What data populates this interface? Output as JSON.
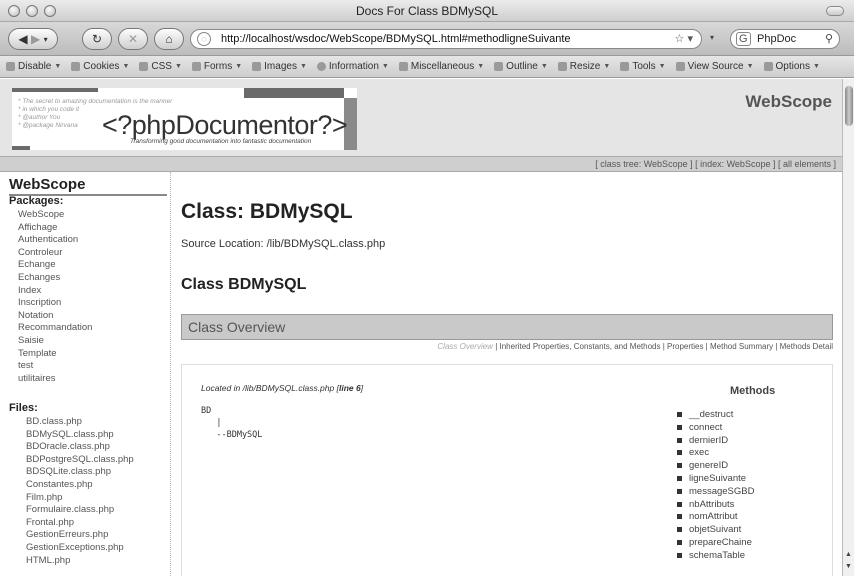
{
  "window": {
    "title": "Docs For Class BDMySQL"
  },
  "nav": {
    "url": "http://localhost/wsdoc/WebScope/BDMySQL.html#methodligneSuivante",
    "search_value": "PhpDoc"
  },
  "devtoolbar": {
    "items": [
      "Disable",
      "Cookies",
      "CSS",
      "Forms",
      "Images",
      "Information",
      "Miscellaneous",
      "Outline",
      "Resize",
      "Tools",
      "View Source",
      "Options"
    ]
  },
  "header": {
    "logo_comment": [
      "* The secret to amazing documentation is the manner",
      "* in which you code it",
      "* @author You",
      "* @package Nirvana"
    ],
    "logo_title": "<?phpDocumentor?>",
    "logo_tagline": "Transforming good documentation into fantastic documentation",
    "brand": "WebScope",
    "links": "[ class tree: WebScope ] [ index: WebScope ] [ all elements ]"
  },
  "sidebar": {
    "title": "WebScope",
    "packages_label": "Packages:",
    "packages": [
      "WebScope",
      "Affichage",
      "Authentication",
      "Controleur",
      "Echange",
      "Echanges",
      "Index",
      "Inscription",
      "Notation",
      "Recommandation",
      "Saisie",
      "Template",
      "test",
      "utilitaires"
    ],
    "files_label": "Files:",
    "files": [
      "BD.class.php",
      "BDMySQL.class.php",
      "BDOracle.class.php",
      "BDPostgreSQL.class.php",
      "BDSQLite.class.php",
      "Constantes.php",
      "Film.php",
      "Formulaire.class.php",
      "Frontal.php",
      "GestionErreurs.php",
      "GestionExceptions.php",
      "HTML.php"
    ]
  },
  "main": {
    "class_heading": "Class: BDMySQL",
    "source_location": "Source Location: /lib/BDMySQL.class.php",
    "sub_heading": "Class BDMySQL",
    "overview_label": "Class Overview",
    "section_nav_current": "Class Overview",
    "section_nav_rest": " | Inherited Properties, Constants, and Methods | Properties | Method Summary | Methods Detail",
    "located_prefix": "Located in /lib/BDMySQL.class.php [",
    "located_line": "line 6",
    "located_suffix": "]",
    "tree": "BD\n   |\n   --BDMySQL",
    "methods_title": "Methods",
    "methods": [
      "__destruct",
      "connect",
      "dernierID",
      "exec",
      "genereID",
      "ligneSuivante",
      "messageSGBD",
      "nbAttributs",
      "nomAttribut",
      "objetSuivant",
      "prepareChaine",
      "schemaTable"
    ]
  }
}
